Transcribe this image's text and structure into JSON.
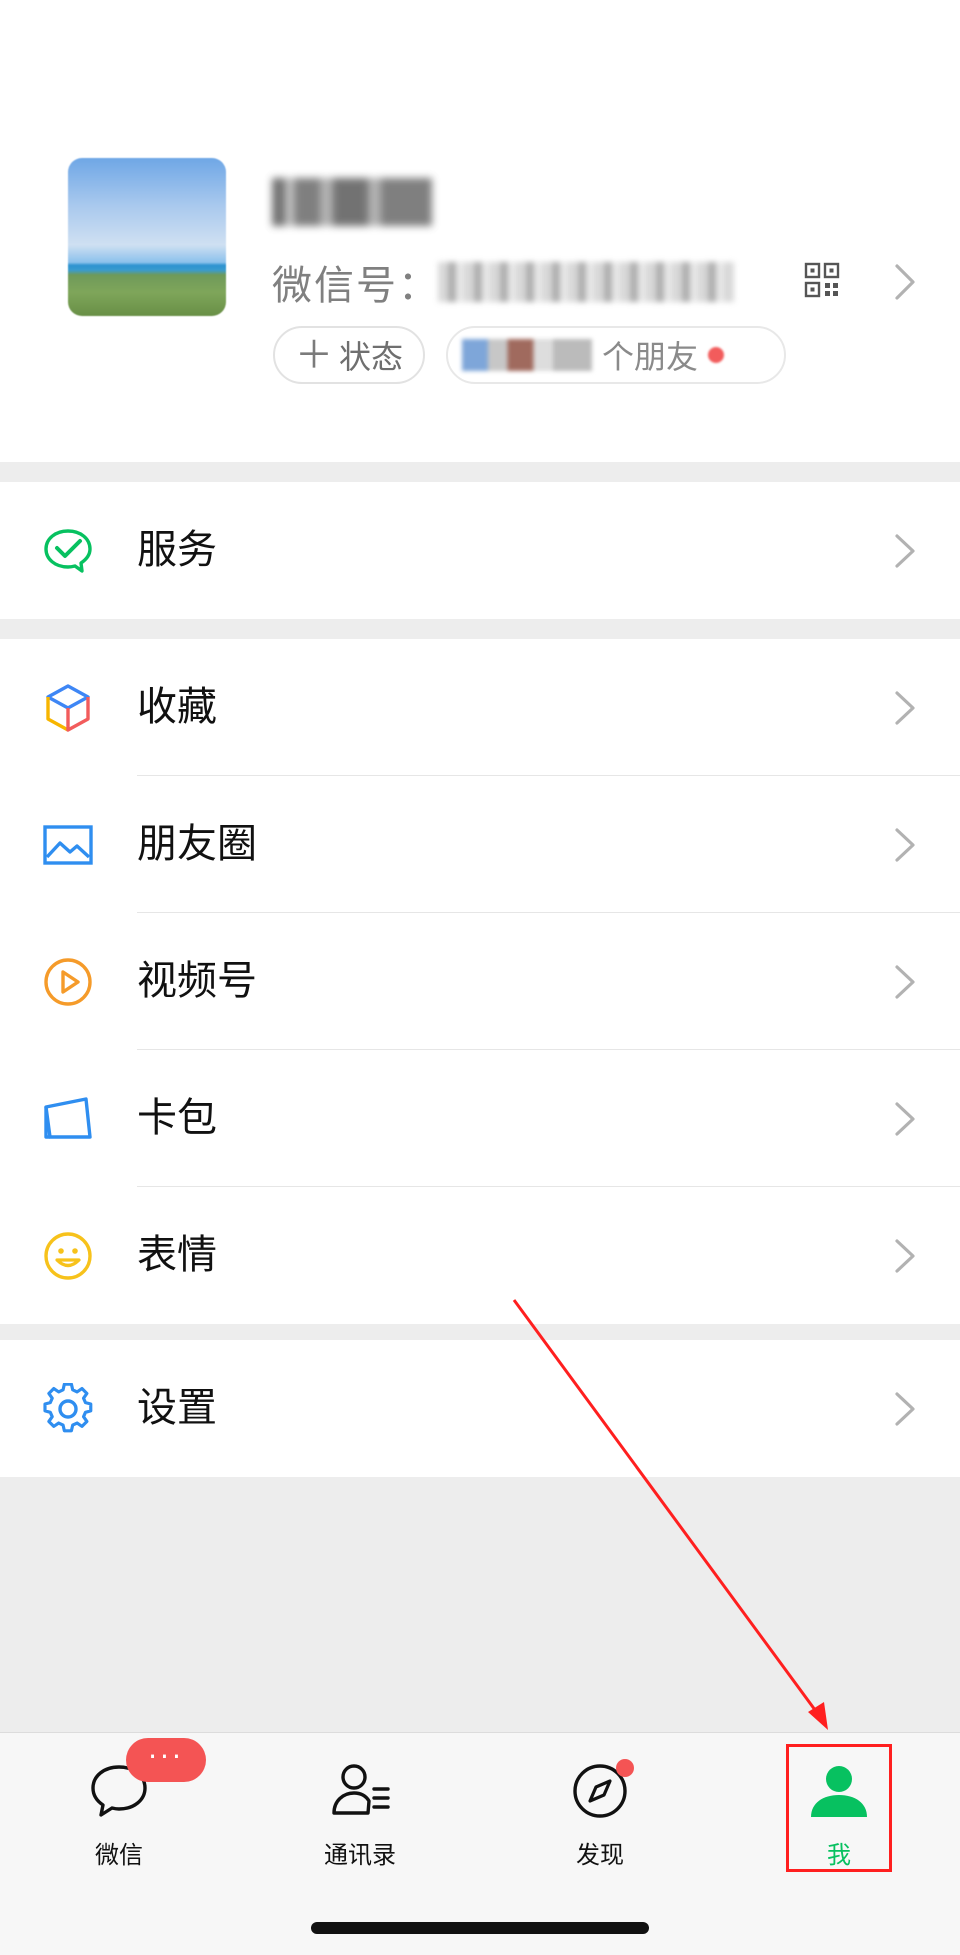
{
  "profile": {
    "wechat_id_label": "微信号：",
    "status_label": "状态",
    "status_plus": "＋",
    "friends_text": "个朋友"
  },
  "menu": {
    "services": "服务",
    "favorites": "收藏",
    "moments": "朋友圈",
    "channels": "视频号",
    "cards": "卡包",
    "stickers": "表情",
    "settings": "设置"
  },
  "tabbar": {
    "chats": "微信",
    "contacts": "通讯录",
    "discover": "发现",
    "me": "我",
    "chats_badge": "···"
  },
  "colors": {
    "accent": "#07c160",
    "badge": "#f45454",
    "annotation": "#ff1f1f"
  },
  "icons": {
    "services": "wechat-pay-check-icon",
    "favorites": "cube-icon",
    "moments": "picture-icon",
    "channels": "play-circle-icon",
    "cards": "card-wallet-icon",
    "stickers": "smiley-icon",
    "settings": "gear-icon",
    "qr": "qr-code-icon"
  }
}
